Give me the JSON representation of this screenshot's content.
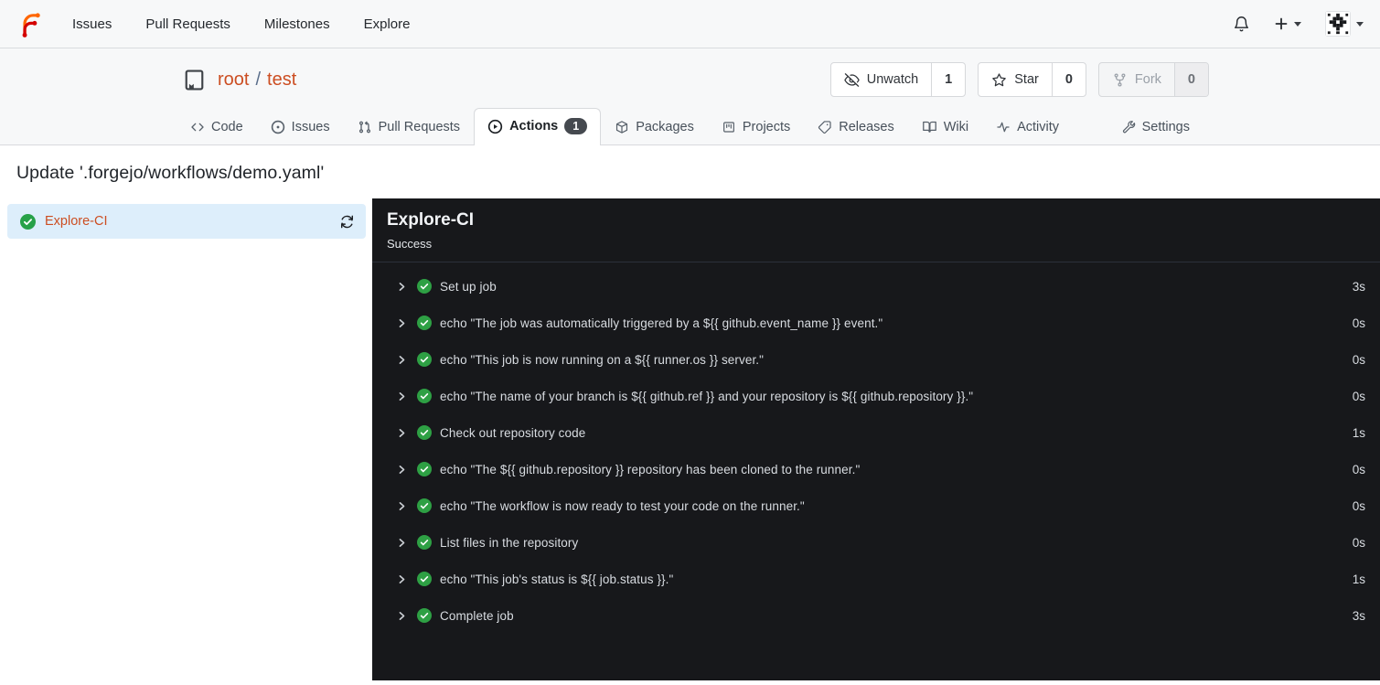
{
  "navbar": {
    "items": [
      {
        "label": "Issues"
      },
      {
        "label": "Pull Requests"
      },
      {
        "label": "Milestones"
      },
      {
        "label": "Explore"
      }
    ]
  },
  "repo": {
    "owner": "root",
    "separator": "/",
    "name": "test",
    "actions": [
      {
        "label": "Unwatch",
        "count": "1"
      },
      {
        "label": "Star",
        "count": "0"
      },
      {
        "label": "Fork",
        "count": "0",
        "disabled": true
      }
    ],
    "tabs": [
      {
        "label": "Code"
      },
      {
        "label": "Issues"
      },
      {
        "label": "Pull Requests"
      },
      {
        "label": "Actions",
        "count": "1",
        "active": true
      },
      {
        "label": "Packages"
      },
      {
        "label": "Projects"
      },
      {
        "label": "Releases"
      },
      {
        "label": "Wiki"
      },
      {
        "label": "Activity"
      },
      {
        "label": "Settings"
      }
    ]
  },
  "page": {
    "title": "Update '.forgejo/workflows/demo.yaml'"
  },
  "jobs_sidebar": {
    "items": [
      {
        "label": "Explore-CI",
        "status": "success",
        "selected": true
      }
    ]
  },
  "run_panel": {
    "title": "Explore-CI",
    "status": "Success",
    "steps": [
      {
        "label": "Set up job",
        "duration": "3s"
      },
      {
        "label": "echo \"The job was automatically triggered by a ${{ github.event_name }} event.\"",
        "duration": "0s"
      },
      {
        "label": "echo \"This job is now running on a ${{ runner.os }} server.\"",
        "duration": "0s"
      },
      {
        "label": "echo \"The name of your branch is ${{ github.ref }} and your repository is ${{ github.repository }}.\"",
        "duration": "0s"
      },
      {
        "label": "Check out repository code",
        "duration": "1s"
      },
      {
        "label": "echo \"The ${{ github.repository }} repository has been cloned to the runner.\"",
        "duration": "0s"
      },
      {
        "label": "echo \"The workflow is now ready to test your code on the runner.\"",
        "duration": "0s"
      },
      {
        "label": "List files in the repository",
        "duration": "0s"
      },
      {
        "label": "echo \"This job's status is ${{ job.status }}.\"",
        "duration": "1s"
      },
      {
        "label": "Complete job",
        "duration": "3s"
      }
    ]
  },
  "colors": {
    "link_accent": "#cc4e22",
    "success_green": "#27a148",
    "panel_background": "#17181b",
    "selected_job_background": "#ddeefb",
    "badge_background": "#45494f",
    "logo_orange": "#ff6600",
    "logo_red": "#d40000",
    "header_background": "#f7f8f9"
  },
  "icons": {
    "forgejo-logo": "curved F glyph, orange+red",
    "bell-icon": "notification bell outline",
    "plus-icon": "+",
    "caret-down-icon": "▾",
    "avatar-identicon": "black/white pixel identicon",
    "repo-book-icon": "book with bookmark",
    "eye-off-icon": "unwatch eye with slash",
    "star-icon": "star outline",
    "fork-icon": "git fork",
    "code-icon": "< >",
    "issue-icon": "circle with dot",
    "pull-request-icon": "git pull request",
    "actions-icon": "play in circle",
    "package-icon": "cube",
    "projects-icon": "kanban board",
    "releases-icon": "tag",
    "wiki-icon": "open book",
    "activity-icon": "pulse line",
    "settings-icon": "wrench",
    "check-circle-icon": "green circle with white check",
    "refresh-icon": "circular arrows",
    "chevron-right-icon": "❯"
  }
}
